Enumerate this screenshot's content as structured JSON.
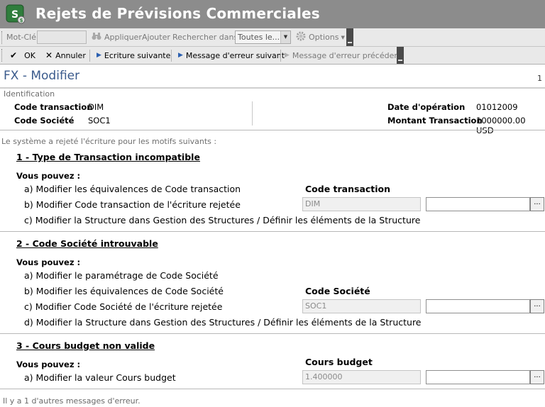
{
  "window": {
    "title": "Rejets de Prévisions Commerciales"
  },
  "toolbar1": {
    "keyword_label": "Mot-Clé",
    "apply_label": "Appliquer",
    "add_label": "Ajouter",
    "search_in_label": "Rechercher dans",
    "search_in_value": "Toutes le...",
    "options_label": "Options"
  },
  "toolbar2": {
    "ok_label": "OK",
    "cancel_label": "Annuler",
    "next_entry_label": "Ecriture suivante",
    "next_error_label": "Message d'erreur suivant",
    "prev_error_label": "Message d'erreur précédent"
  },
  "form": {
    "title": "FX - Modifier",
    "page": "1"
  },
  "identification": {
    "heading": "Identification",
    "code_transaction_label": "Code transaction",
    "code_transaction_value": "DIM",
    "code_societe_label": "Code Société",
    "code_societe_value": "SOC1",
    "date_operation_label": "Date d'opération",
    "date_operation_value": "01012009",
    "montant_label": "Montant Transaction",
    "montant_value": "1000000.00 USD"
  },
  "intro": "Le système a rejeté l'écriture pour les motifs suivants :",
  "sections": [
    {
      "title": "1 - Type de Transaction incompatible",
      "you_can": "Vous pouvez :",
      "items": [
        "a) Modifier les équivalences de Code transaction",
        "b) Modifier Code transaction de l'écriture rejetée",
        "c) Modifier la Structure dans Gestion des Structures / Définir les éléments de la Structure"
      ],
      "column_header": "Code transaction",
      "readonly_value": "DIM",
      "edit_value": ""
    },
    {
      "title": "2 - Code Société introuvable",
      "you_can": "Vous pouvez :",
      "items": [
        "a) Modifier le paramétrage de Code Société",
        "b) Modifier les équivalences de Code Société",
        "c) Modifier Code Société de l'écriture rejetée",
        "d) Modifier la Structure dans Gestion des Structures / Définir les éléments de la Structure"
      ],
      "column_header": "Code Société",
      "readonly_value": "SOC1",
      "edit_value": ""
    },
    {
      "title": "3 - Cours budget non valide",
      "you_can": "Vous pouvez :",
      "items": [
        "a) Modifier la valeur Cours budget"
      ],
      "column_header": "Cours budget",
      "readonly_value": "1.400000",
      "edit_value": ""
    }
  ],
  "browse_label": "...",
  "footer": "Il y a  1 d'autres messages d'erreur.",
  "colors": {
    "title_bar": "#8c8c8c",
    "form_title": "#3a5a8c",
    "toolbar": "#e9e9e9"
  }
}
